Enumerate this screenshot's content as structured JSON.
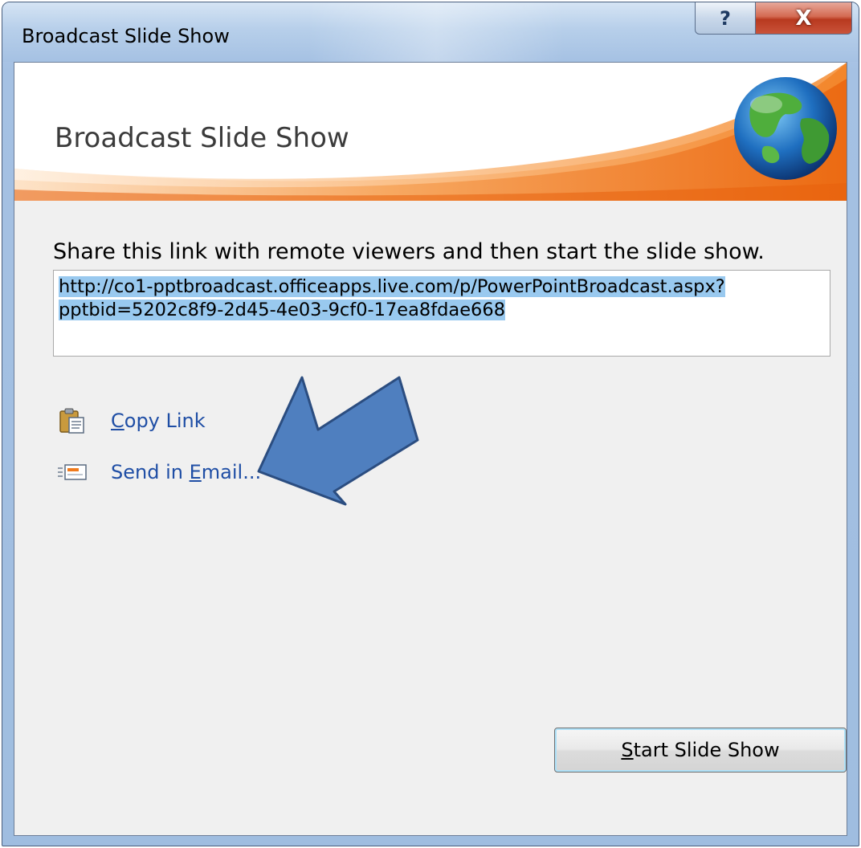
{
  "window": {
    "title": "Broadcast Slide Show"
  },
  "caption": {
    "help_glyph": "?",
    "close_glyph": "X"
  },
  "banner": {
    "title": "Broadcast Slide Show",
    "icon": "globe-icon"
  },
  "instruction": "Share this link with remote viewers and then start the slide show.",
  "link": {
    "line1": "http://co1-pptbroadcast.officeapps.live.com/p/PowerPointBroadcast.aspx?",
    "line2": "pptbid=5202c8f9-2d45-4e03-9cf0-17ea8fdae668"
  },
  "actions": {
    "copy_link": {
      "mnemonic": "C",
      "rest": "opy Link",
      "icon": "clipboard-icon"
    },
    "send_email": {
      "prefix": "Send in ",
      "mnemonic": "E",
      "rest": "mail...",
      "icon": "email-icon"
    }
  },
  "annotation": {
    "icon": "arrow-pointer-icon",
    "color": "#4f7fbf"
  },
  "start_button": {
    "mnemonic": "S",
    "rest": "tart Slide Show"
  },
  "colors": {
    "accent_orange": "#f07a1c",
    "link_blue": "#1f4ea5",
    "selection": "#99c9ef"
  }
}
